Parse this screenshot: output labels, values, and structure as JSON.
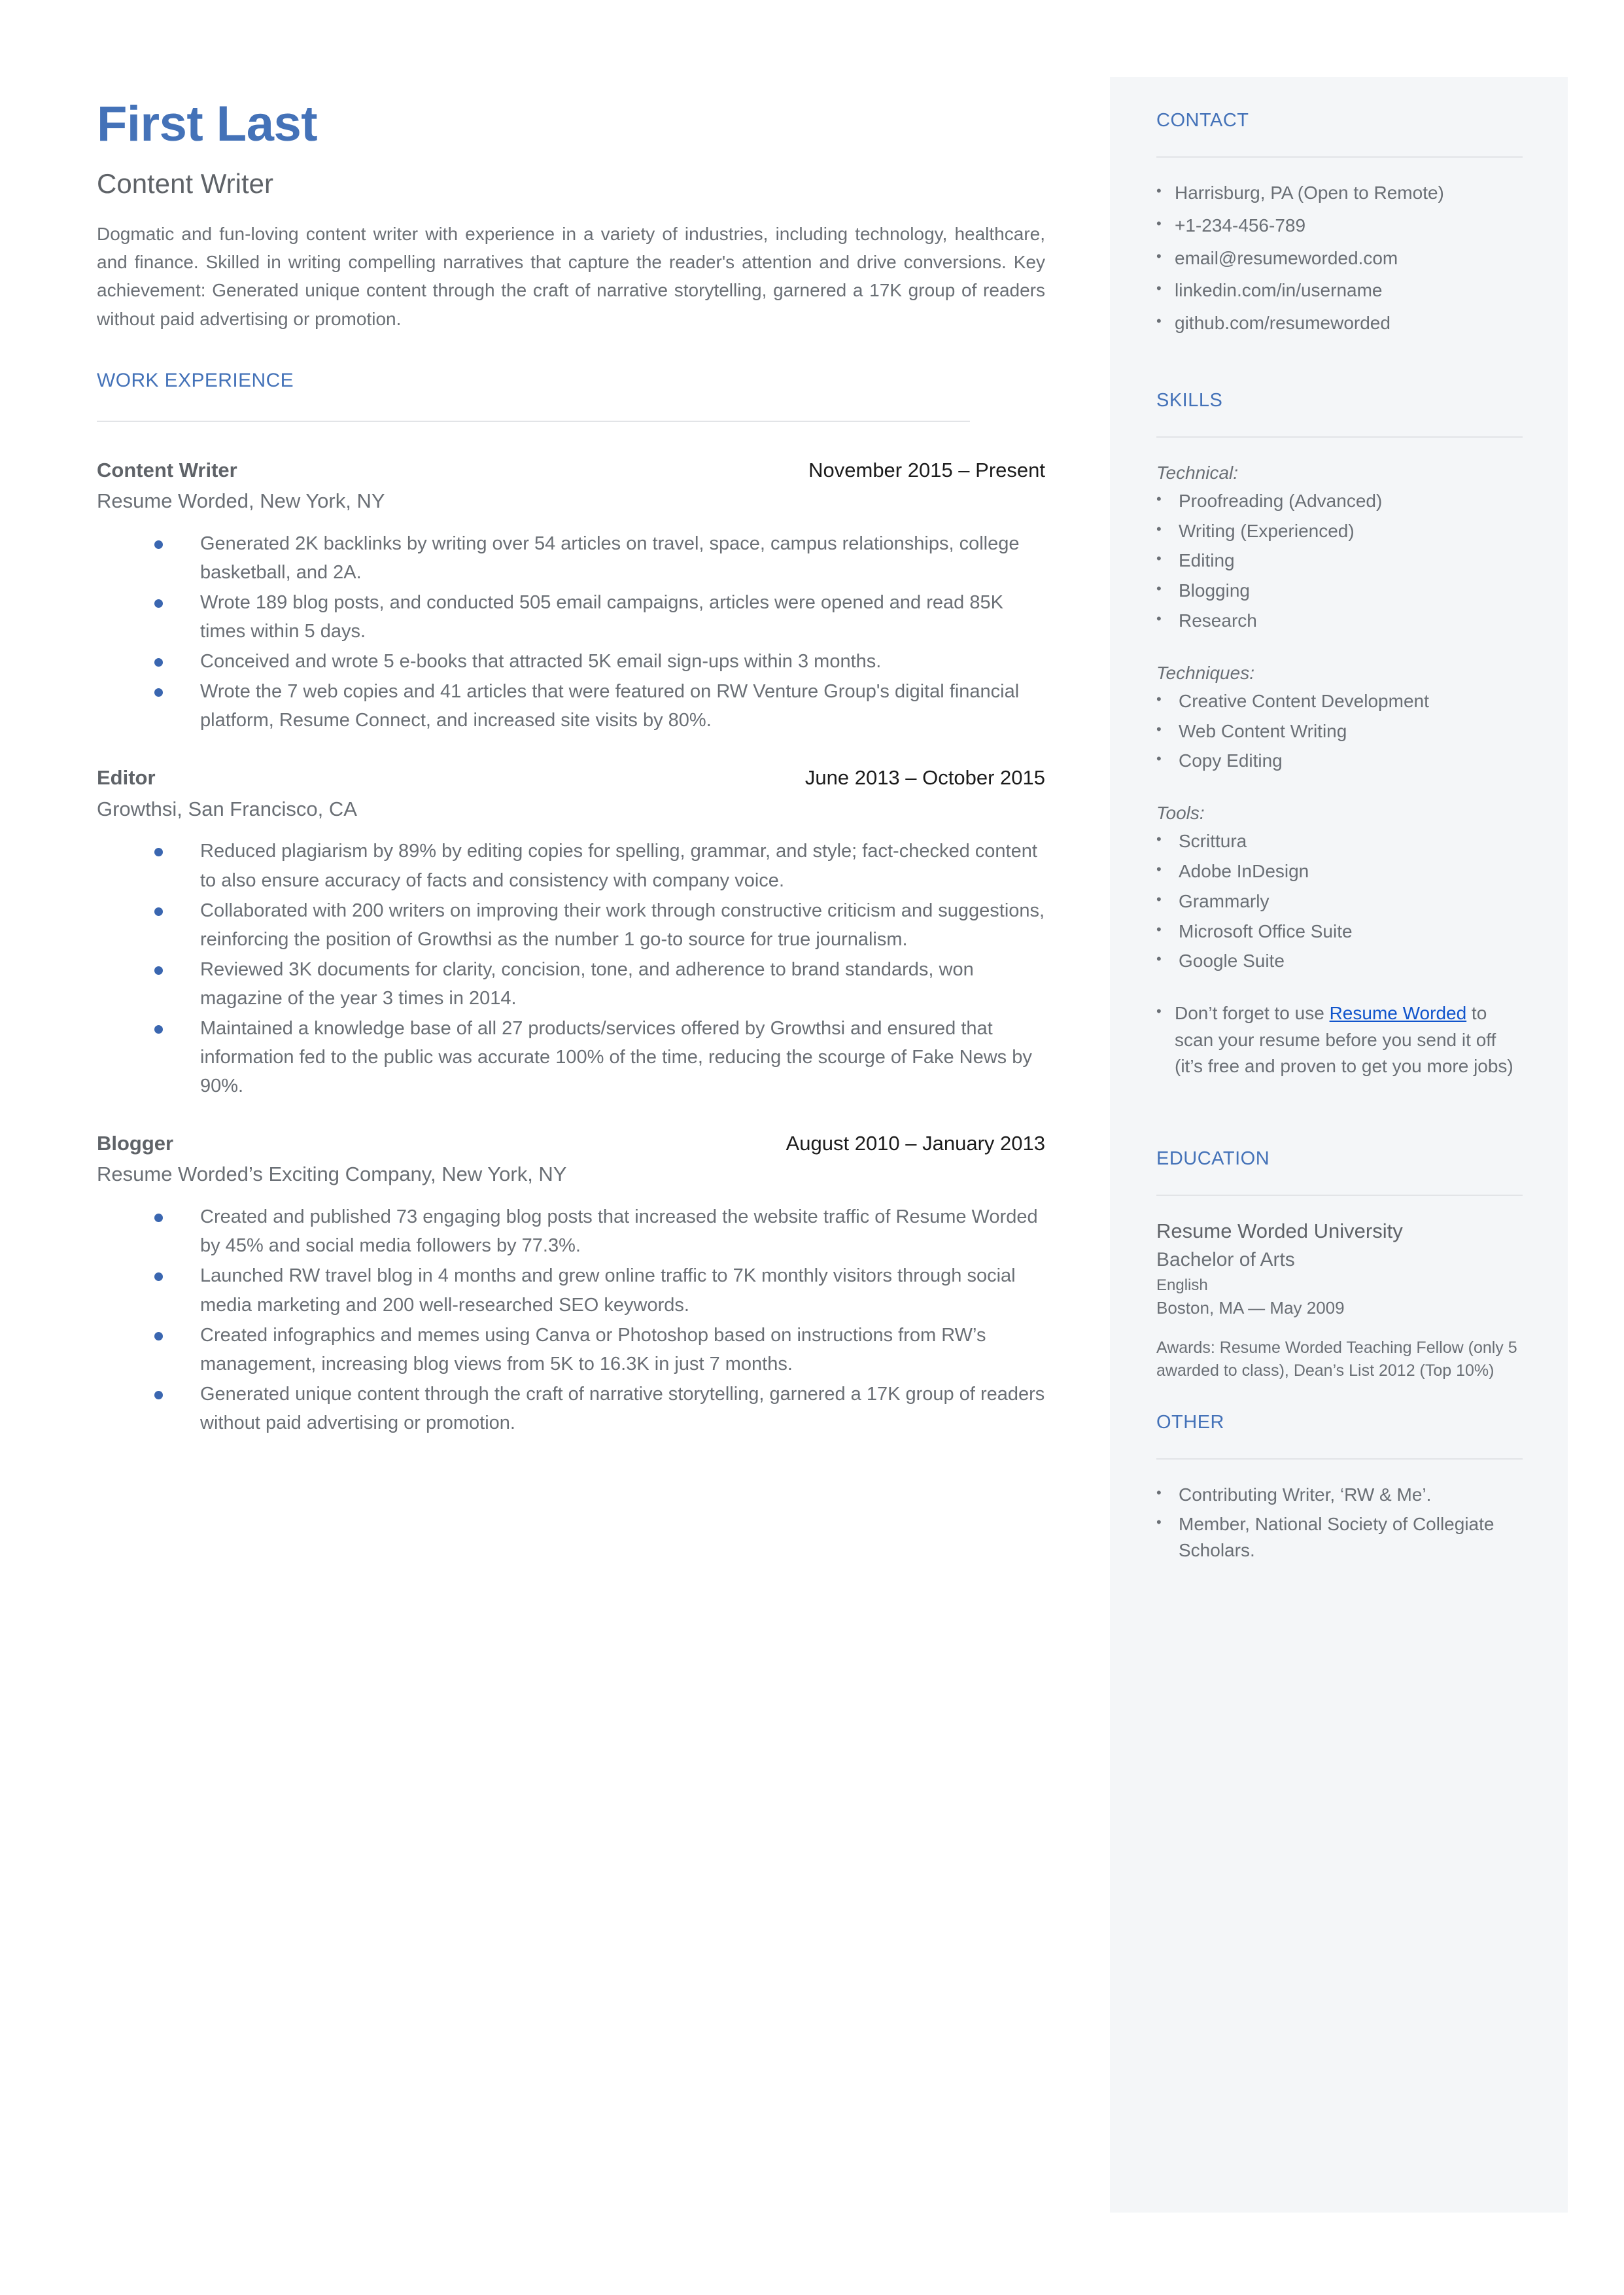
{
  "header": {
    "name": "First Last",
    "title": "Content Writer",
    "summary": "Dogmatic and fun-loving content writer with experience in a variety of industries, including technology, healthcare, and finance. Skilled in writing compelling narratives that capture the reader's attention and drive conversions. Key achievement: Generated unique content through the craft of narrative storytelling, garnered a 17K group of readers without paid advertising or promotion."
  },
  "colors": {
    "accent_blue": "#4472b8",
    "link_blue": "#1155cc",
    "bullet_blue": "#3a66b0",
    "body_gray": "#6a6f75",
    "sidebar_bg": "#f4f6f8",
    "rule_gray": "#e2e4e7"
  },
  "work": {
    "heading": "WORK EXPERIENCE",
    "jobs": [
      {
        "role": "Content Writer",
        "dates": "November 2015 – Present",
        "company": "Resume Worded, New York, NY",
        "bullets": [
          "Generated 2K backlinks by writing over 54 articles on travel, space, campus relationships, college basketball, and 2A.",
          "Wrote 189 blog posts, and conducted 505 email campaigns, articles were opened and read 85K times within 5 days.",
          "Conceived and wrote 5 e-books that attracted 5K email sign-ups within 3 months.",
          "Wrote the 7 web copies and 41 articles that were featured on RW Venture Group's digital financial platform, Resume Connect, and increased site visits by 80%."
        ]
      },
      {
        "role": "Editor",
        "dates": "June 2013 – October 2015",
        "company": "Growthsi, San Francisco, CA",
        "bullets": [
          "Reduced plagiarism by 89% by editing copies for spelling, grammar, and style; fact-checked content to also ensure accuracy of facts and consistency with company voice.",
          "Collaborated with 200 writers on improving their work through constructive criticism and suggestions, reinforcing the position of Growthsi as the number 1 go-to source for true journalism.",
          "Reviewed 3K documents for clarity, concision, tone, and adherence to brand standards, won magazine of the year 3 times in 2014.",
          "Maintained a knowledge base of all 27 products/services offered by Growthsi and ensured that information fed to the public was accurate 100% of the time, reducing the scourge of Fake News by 90%."
        ]
      },
      {
        "role": "Blogger",
        "dates": "August 2010 – January 2013",
        "company": "Resume Worded’s Exciting Company, New York, NY",
        "bullets": [
          "Created and published 73 engaging blog posts that increased the website traffic of Resume Worded by 45% and social media followers by 77.3%.",
          "Launched RW travel blog in 4 months and grew online traffic to 7K monthly visitors through social media marketing and 200 well-researched SEO keywords.",
          "Created infographics and memes using Canva or Photoshop based on instructions from RW’s management, increasing blog views from 5K to 16.3K in just 7 months.",
          "Generated unique content through the craft of narrative storytelling, garnered a 17K group of readers without paid advertising or promotion."
        ]
      }
    ]
  },
  "contact": {
    "heading": "CONTACT",
    "items": [
      "Harrisburg, PA (Open to Remote)",
      "+1-234-456-789",
      "email@resumeworded.com",
      "linkedin.com/in/username",
      "github.com/resumeworded"
    ]
  },
  "skills": {
    "heading": "SKILLS",
    "groups": [
      {
        "label": "Technical:",
        "items": [
          "Proofreading (Advanced)",
          "Writing (Experienced)",
          "Editing",
          "Blogging",
          "Research"
        ]
      },
      {
        "label": "Techniques:",
        "items": [
          "Creative Content Development",
          "Web Content Writing",
          "Copy Editing"
        ]
      },
      {
        "label": "Tools:",
        "items": [
          "Scrittura",
          "Adobe InDesign",
          "Grammarly",
          "Microsoft Office Suite",
          "Google Suite"
        ]
      }
    ],
    "promo": {
      "before": "Don’t forget to use ",
      "link": "Resume Worded",
      "after": " to scan your resume before you send it off (it’s free and proven to get you more jobs)"
    }
  },
  "education": {
    "heading": "EDUCATION",
    "school": "Resume Worded University",
    "degree": "Bachelor of Arts",
    "field": "English",
    "location": "Boston, MA — May 2009",
    "awards": "Awards: Resume Worded Teaching Fellow (only 5 awarded to class), Dean’s List 2012 (Top 10%)"
  },
  "other": {
    "heading": "OTHER",
    "items": [
      "Contributing Writer, ‘RW & Me’.",
      "Member, National Society of Collegiate Scholars."
    ]
  }
}
